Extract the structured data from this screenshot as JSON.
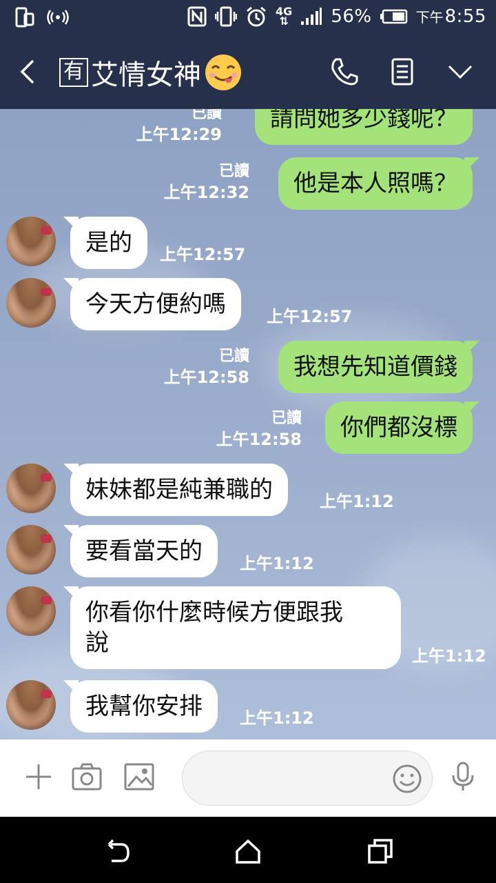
{
  "status_bar": {
    "battery": "56%",
    "ampm": "下午",
    "time": "8:55",
    "network": "4G"
  },
  "header": {
    "title_boxed_char": "有",
    "title": "艾情女神",
    "icons": [
      "back-icon",
      "phone-icon",
      "notes-icon",
      "chevron-down-icon"
    ]
  },
  "messages": [
    {
      "side": "me",
      "text": "請問她多少錢呢？",
      "read": "已讀",
      "time": "上午12:29"
    },
    {
      "side": "me",
      "text": "他是本人照嗎？",
      "read": "已讀",
      "time": "上午12:32"
    },
    {
      "side": "them",
      "text": "是的",
      "time": "上午12:57"
    },
    {
      "side": "them",
      "text": "今天方便約嗎",
      "time": "上午12:57"
    },
    {
      "side": "me",
      "text": "我想先知道價錢",
      "read": "已讀",
      "time": "上午12:58"
    },
    {
      "side": "me",
      "text": "你們都沒標",
      "read": "已讀",
      "time": "上午12:58"
    },
    {
      "side": "them",
      "text": "妹妹都是純兼職的",
      "time": "上午1:12"
    },
    {
      "side": "them",
      "text": "要看當天的",
      "time": "上午1:12"
    },
    {
      "side": "them",
      "text_line1": "你看你什麼時候方便跟我",
      "text_line2": "說",
      "time": "上午1:12"
    },
    {
      "side": "them",
      "text": "我幫你安排",
      "time": "上午1:12"
    }
  ],
  "input_bar": {
    "placeholder": "",
    "icons": [
      "plus-icon",
      "camera-icon",
      "image-icon",
      "emoji-icon",
      "microphone-icon"
    ]
  },
  "colors": {
    "header_bg": "#26304a",
    "my_bubble": "#a4e27a",
    "their_bubble": "#ffffff",
    "chat_bg": "#97a9c9"
  }
}
